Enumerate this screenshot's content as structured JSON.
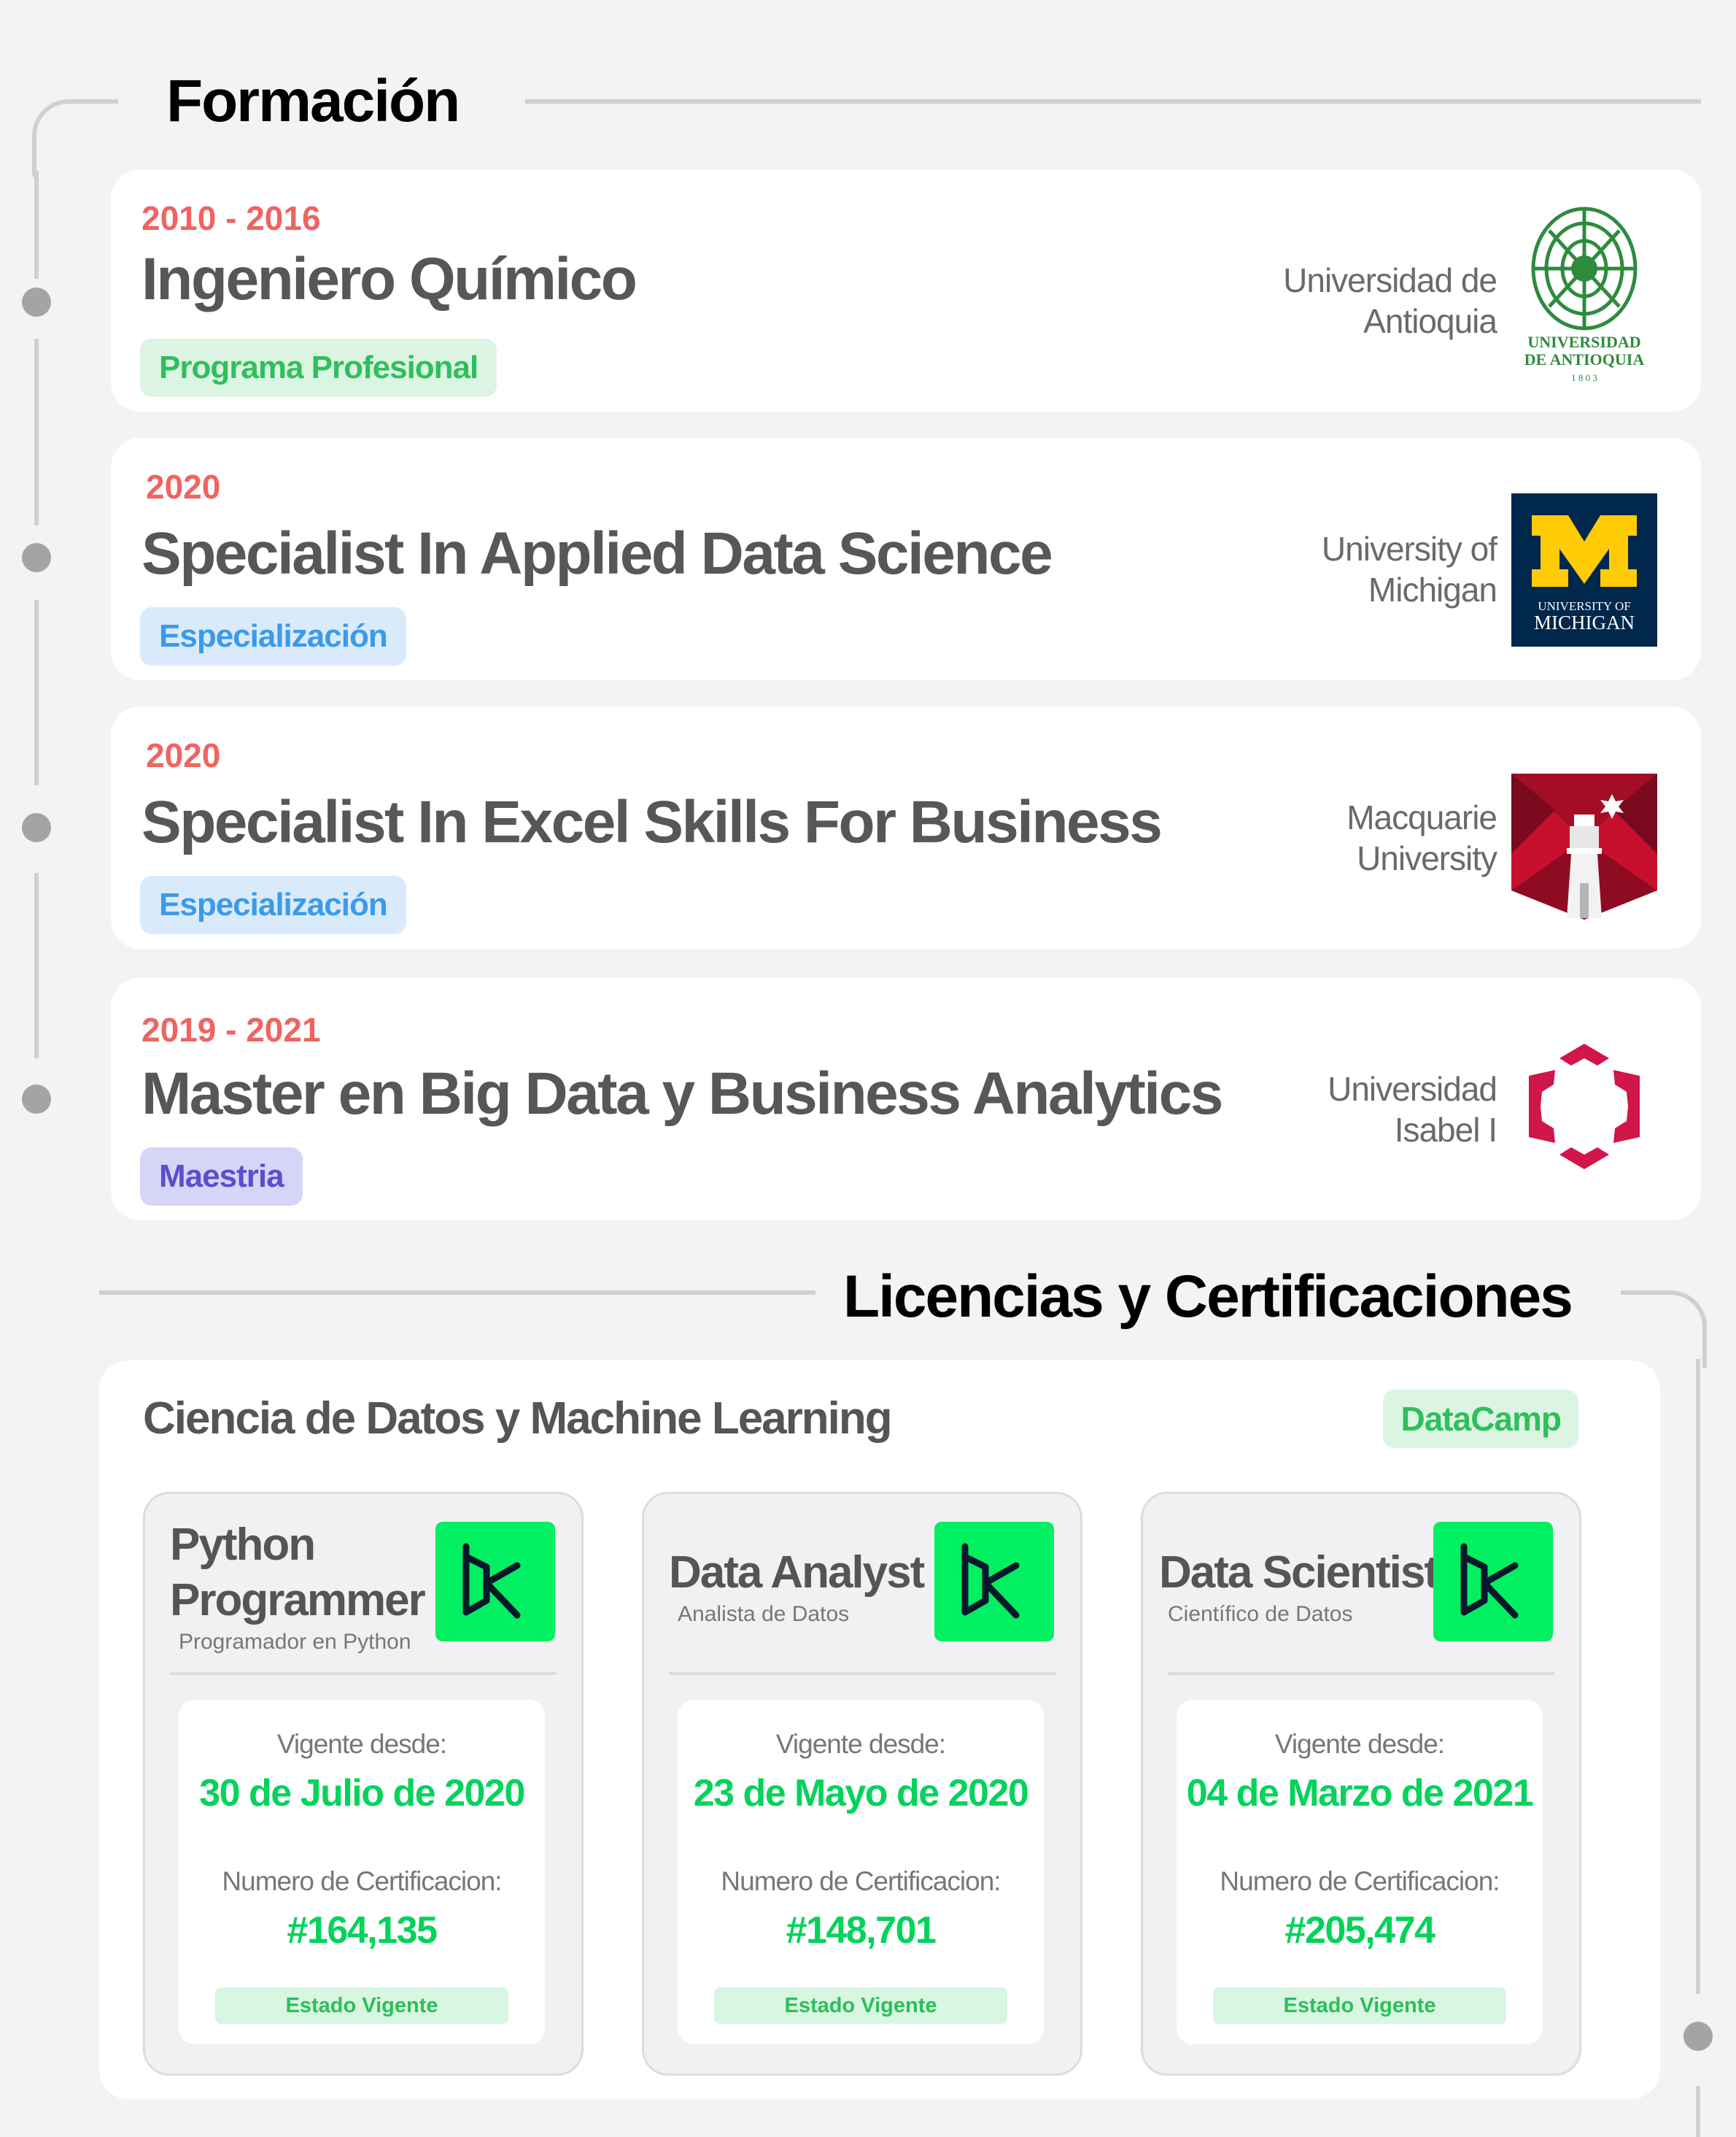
{
  "formacion": {
    "title": "Formación",
    "items": [
      {
        "years": "2010 - 2016",
        "title": "Ingeniero Químico",
        "badge": "Programa Profesional",
        "uni_line1": "Universidad de",
        "uni_line2": "Antioquia",
        "logo_text1": "UNIVERSIDAD",
        "logo_text2": "DE ANTIOQUIA",
        "logo_text3": "1 8 0 3"
      },
      {
        "years": "2020",
        "title": "Specialist In Applied Data Science",
        "badge": "Especialización",
        "uni_line1": "University of",
        "uni_line2": "Michigan",
        "logo_text1": "UNIVERSITY OF",
        "logo_text2": "MICHIGAN"
      },
      {
        "years": "2020",
        "title": "Specialist In Excel Skills For Business",
        "badge": "Especialización",
        "uni_line1": "Macquarie",
        "uni_line2": "University"
      },
      {
        "years": "2019 - 2021",
        "title": "Master en Big Data y Business Analytics",
        "badge": "Maestria",
        "uni_line1": "Universidad",
        "uni_line2": "Isabel I"
      }
    ]
  },
  "licencias": {
    "title": "Licencias y Certificaciones",
    "group_title": "Ciencia de Datos y Machine Learning",
    "provider": "DataCamp",
    "certs": [
      {
        "name_line1": "Python",
        "name_line2": "Programmer",
        "subtitle": "Programador en Python",
        "since_label": "Vigente desde:",
        "since": "30 de Julio de 2020",
        "number_label": "Numero de Certificacion:",
        "number": "#164,135",
        "status": "Estado Vigente"
      },
      {
        "name_line1": "Data Analyst",
        "subtitle": "Analista de Datos",
        "since_label": "Vigente desde:",
        "since": "23 de Mayo de 2020",
        "number_label": "Numero de Certificacion:",
        "number": "#148,701",
        "status": "Estado Vigente"
      },
      {
        "name_line1": "Data Scientist",
        "subtitle": "Científico de Datos",
        "since_label": "Vigente desde:",
        "since": "04 de Marzo de 2021",
        "number_label": "Numero de Certificacion:",
        "number": "#205,474",
        "status": "Estado Vigente"
      }
    ]
  },
  "colors": {
    "year": "#ef6461",
    "datacamp_green": "#03ef62",
    "michigan_blue": "#00274c",
    "michigan_maize": "#ffcb05",
    "antioquia_green": "#2e8b3e",
    "macquarie_red": "#c8102e"
  }
}
